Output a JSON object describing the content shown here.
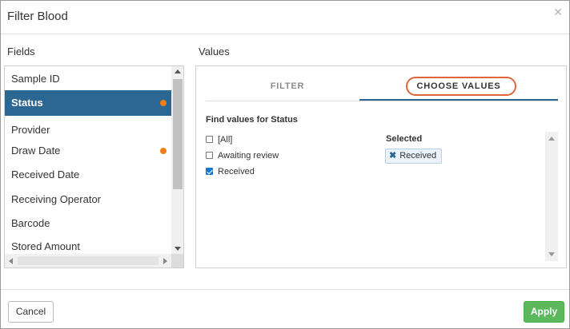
{
  "dialog": {
    "title": "Filter Blood",
    "close_icon": "close-icon"
  },
  "fields": {
    "label": "Fields",
    "items": [
      {
        "label": "Sample ID",
        "selected": false,
        "has_filter": false
      },
      {
        "label": "Status",
        "selected": true,
        "has_filter": true
      },
      {
        "label": "Provider",
        "selected": false,
        "has_filter": false
      },
      {
        "label": "Draw Date",
        "selected": false,
        "has_filter": true
      },
      {
        "label": "Received Date",
        "selected": false,
        "has_filter": false
      },
      {
        "label": "Receiving Operator",
        "selected": false,
        "has_filter": false
      },
      {
        "label": "Barcode",
        "selected": false,
        "has_filter": false
      },
      {
        "label": "Stored Amount",
        "selected": false,
        "has_filter": false
      }
    ],
    "filter_dot_color": "#f07d14",
    "selected_color": "#2c6794"
  },
  "values": {
    "label": "Values",
    "tabs": [
      {
        "label": "FILTER",
        "active": false
      },
      {
        "label": "CHOOSE VALUES",
        "active": true
      }
    ],
    "find_label": "Find values for Status",
    "options": [
      {
        "label": "[All]",
        "checked": false
      },
      {
        "label": "Awaiting review",
        "checked": false
      },
      {
        "label": "Received",
        "checked": true
      }
    ],
    "selected_label": "Selected",
    "selected_chips": [
      {
        "label": "Received",
        "remove_icon": "remove-x-icon"
      }
    ],
    "highlight_color": "#e0653a"
  },
  "footer": {
    "cancel_label": "Cancel",
    "apply_label": "Apply",
    "apply_color": "#5cb85c"
  }
}
